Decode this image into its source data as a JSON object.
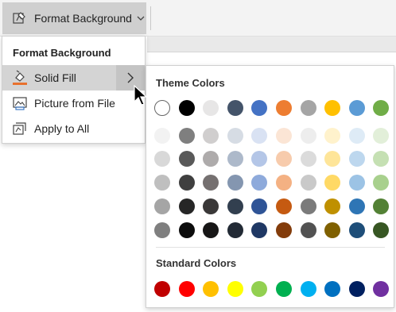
{
  "ribbon": {
    "button_label": "Format Background",
    "button_icon": "format-background-icon",
    "chevron_icon": "chevron-down-icon"
  },
  "menu": {
    "header": "Format Background",
    "items": [
      {
        "label": "Solid Fill",
        "icon": "paint-bucket-icon",
        "has_submenu": true
      },
      {
        "label": "Picture from File",
        "icon": "picture-icon",
        "has_submenu": false
      },
      {
        "label": "Apply to All",
        "icon": "apply-all-icon",
        "has_submenu": false
      }
    ],
    "submenu_arrow": "chevron-right-icon"
  },
  "flyout": {
    "theme_heading": "Theme Colors",
    "standard_heading": "Standard Colors",
    "theme_rows": [
      [
        "#ffffff",
        "#000000",
        "#e7e6e6",
        "#44546a",
        "#4472c4",
        "#ed7d31",
        "#a5a5a5",
        "#ffc000",
        "#5b9bd5",
        "#70ad47"
      ],
      [
        "#f2f2f2",
        "#7f7f7f",
        "#d0cece",
        "#d6dce4",
        "#d9e2f3",
        "#fbe5d5",
        "#ededed",
        "#fff2cc",
        "#deebf6",
        "#e2efd9"
      ],
      [
        "#d8d8d8",
        "#595959",
        "#aeabab",
        "#adb9ca",
        "#b4c6e7",
        "#f7cbac",
        "#dbdbdb",
        "#fee599",
        "#bdd7ee",
        "#c5e0b3"
      ],
      [
        "#bfbfbf",
        "#3f3f3f",
        "#757070",
        "#8496b0",
        "#8eaadb",
        "#f4b183",
        "#c9c9c9",
        "#ffd965",
        "#9cc3e5",
        "#a8d08d"
      ],
      [
        "#a5a5a5",
        "#262626",
        "#3a3838",
        "#323f4f",
        "#2f5496",
        "#c55a11",
        "#7b7b7b",
        "#bf9000",
        "#2e75b5",
        "#538135"
      ],
      [
        "#7f7f7f",
        "#0c0c0c",
        "#171616",
        "#222a35",
        "#1f3864",
        "#833c0b",
        "#525252",
        "#7f6000",
        "#1e4e79",
        "#375623"
      ]
    ],
    "standard_row": [
      "#c00000",
      "#ff0000",
      "#ffc000",
      "#ffff00",
      "#92d050",
      "#00b050",
      "#00b0f0",
      "#0070c0",
      "#002060",
      "#7030a0"
    ]
  }
}
